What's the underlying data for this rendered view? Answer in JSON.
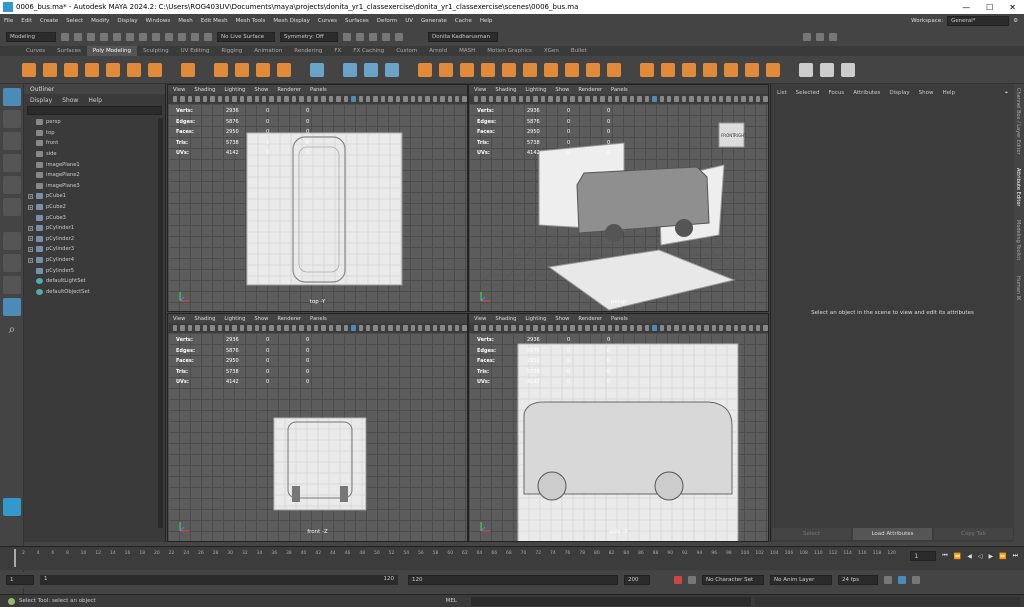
{
  "title": "0006_bus.ma* - Autodesk MAYA 2024.2: C:\\Users\\ROG403UV\\Documents\\maya\\projects\\donita_yr1_classexercise\\donita_yr1_classexercise\\scenes\\0006_bus.ma",
  "menu": [
    "File",
    "Edit",
    "Create",
    "Select",
    "Modify",
    "Display",
    "Windows",
    "Mesh",
    "Edit Mesh",
    "Mesh Tools",
    "Mesh Display",
    "Curves",
    "Surfaces",
    "Deform",
    "UV",
    "Generate",
    "Cache",
    "Help"
  ],
  "workspace": {
    "label": "Workspace:",
    "value": "General*"
  },
  "status": {
    "mode": "Modeling",
    "live_surface": "No Live Surface",
    "symmetry": "Symmetry: Off",
    "user": "Donita Kadharusman"
  },
  "shelf_tabs": [
    "Curves",
    "Surfaces",
    "Poly Modeling",
    "Sculpting",
    "UV Editing",
    "Rigging",
    "Animation",
    "Rendering",
    "FX",
    "FX Caching",
    "Custom",
    "Arnold",
    "MASH",
    "Motion Graphics",
    "XGen",
    "Bullet"
  ],
  "outliner": {
    "title": "Outliner",
    "menu": [
      "Display",
      "Show",
      "Help"
    ],
    "items": [
      {
        "label": "persp",
        "icon": "camera-icon"
      },
      {
        "label": "top",
        "icon": "camera-icon"
      },
      {
        "label": "front",
        "icon": "camera-icon"
      },
      {
        "label": "side",
        "icon": "camera-icon"
      },
      {
        "label": "imagePlane1",
        "icon": "image-plane-icon"
      },
      {
        "label": "imagePlane2",
        "icon": "image-plane-icon"
      },
      {
        "label": "imagePlane3",
        "icon": "image-plane-icon"
      },
      {
        "label": "pCube1",
        "icon": "mesh-icon",
        "expand": true
      },
      {
        "label": "pCube2",
        "icon": "mesh-icon",
        "expand": true
      },
      {
        "label": "pCube3",
        "icon": "mesh-icon"
      },
      {
        "label": "pCylinder1",
        "icon": "mesh-icon",
        "expand": true
      },
      {
        "label": "pCylinder2",
        "icon": "mesh-icon",
        "expand": true
      },
      {
        "label": "pCylinder3",
        "icon": "mesh-icon",
        "expand": true
      },
      {
        "label": "pCylinder4",
        "icon": "mesh-icon",
        "expand": true
      },
      {
        "label": "pCylinder5",
        "icon": "mesh-icon"
      },
      {
        "label": "defaultLightSet",
        "icon": "set-icon"
      },
      {
        "label": "defaultObjectSet",
        "icon": "set-icon"
      }
    ]
  },
  "viewport_menu": [
    "View",
    "Shading",
    "Lighting",
    "Show",
    "Renderer",
    "Panels"
  ],
  "hud": {
    "labels": [
      "Verts:",
      "Edges:",
      "Faces:",
      "Tris:",
      "UVs:"
    ],
    "values": [
      "2936",
      "5876",
      "2950",
      "5738",
      "4142"
    ],
    "zero": "0"
  },
  "viewports": {
    "top": "top -Y",
    "persp": "persp",
    "front": "front -Z",
    "side": "side -X"
  },
  "viewcube": {
    "front": "FRONT",
    "right": "RIGHT"
  },
  "attr": {
    "menu": [
      "List",
      "Selected",
      "Focus",
      "Attributes",
      "Display",
      "Show",
      "Help"
    ],
    "message": "Select an object in the scene to view and edit its attributes",
    "buttons": [
      "Select",
      "Load Attributes",
      "Copy Tab"
    ]
  },
  "side_tabs": [
    "Channel Box / Layer Editor",
    "Attribute Editor",
    "Modeling Toolkit",
    "Human IK"
  ],
  "timeline": {
    "ticks": [
      "2",
      "4",
      "6",
      "8",
      "10",
      "12",
      "14",
      "16",
      "18",
      "20",
      "22",
      "24",
      "26",
      "28",
      "30",
      "32",
      "34",
      "36",
      "38",
      "40",
      "42",
      "44",
      "46",
      "48",
      "50",
      "52",
      "54",
      "56",
      "58",
      "60",
      "62",
      "64",
      "66",
      "68",
      "70",
      "72",
      "74",
      "76",
      "78",
      "80",
      "82",
      "84",
      "86",
      "88",
      "90",
      "92",
      "94",
      "96",
      "98",
      "100",
      "102",
      "104",
      "106",
      "108",
      "110",
      "112",
      "114",
      "116",
      "118",
      "120"
    ],
    "current": "1"
  },
  "range": {
    "start": "1",
    "inner_start": "1",
    "inner_end": "120",
    "end_a": "120",
    "end_b": "200",
    "character": "No Character Set",
    "anim_layer": "No Anim Layer",
    "fps": "24 fps"
  },
  "help": {
    "text": "Select Tool: select an object",
    "mel": "MEL"
  },
  "colors": {
    "accent": "#4b8bb8",
    "shelf_orange": "#e08a3a"
  }
}
